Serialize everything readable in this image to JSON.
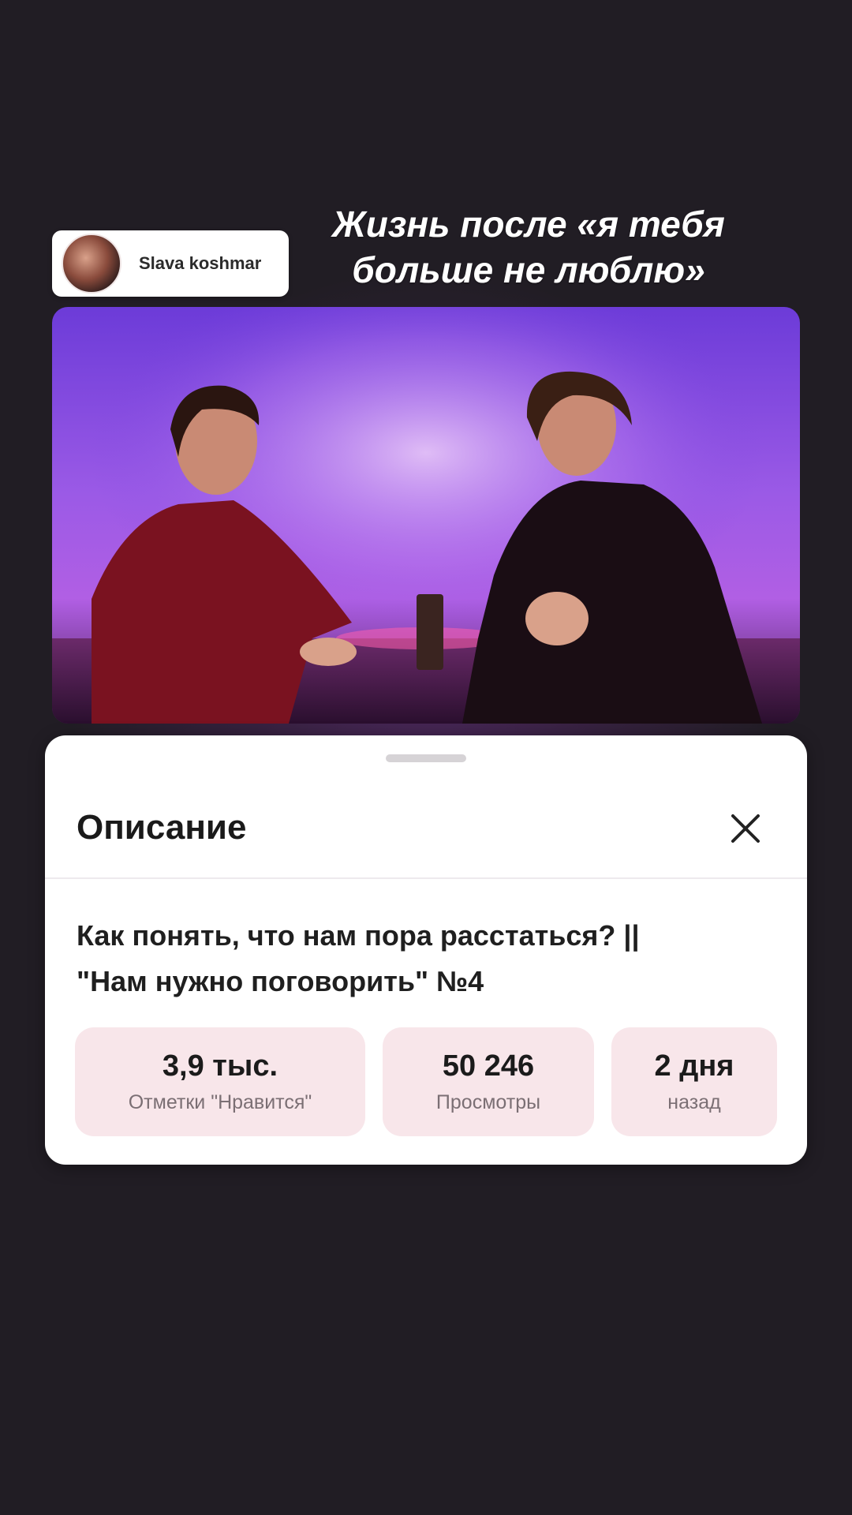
{
  "story": {
    "caption_line1": "Жизнь после «я тебя",
    "caption_line2": "больше не люблю»",
    "author_name": "Slava koshmar"
  },
  "sheet": {
    "title": "Описание",
    "close_icon": "close-icon",
    "video_title_line1": "Как понять, что нам пора расстаться? ||",
    "video_title_line2": "\"Нам нужно поговорить\" №4",
    "stats": [
      {
        "value": "3,9 тыс.",
        "label": "Отметки \"Нравится\""
      },
      {
        "value": "50 246",
        "label": "Просмотры"
      },
      {
        "value": "2 дня",
        "label": "назад"
      }
    ]
  },
  "colors": {
    "background": "#211d24",
    "stat_chip": "#f8e6ea",
    "video_purple": "#9b5ae6"
  }
}
